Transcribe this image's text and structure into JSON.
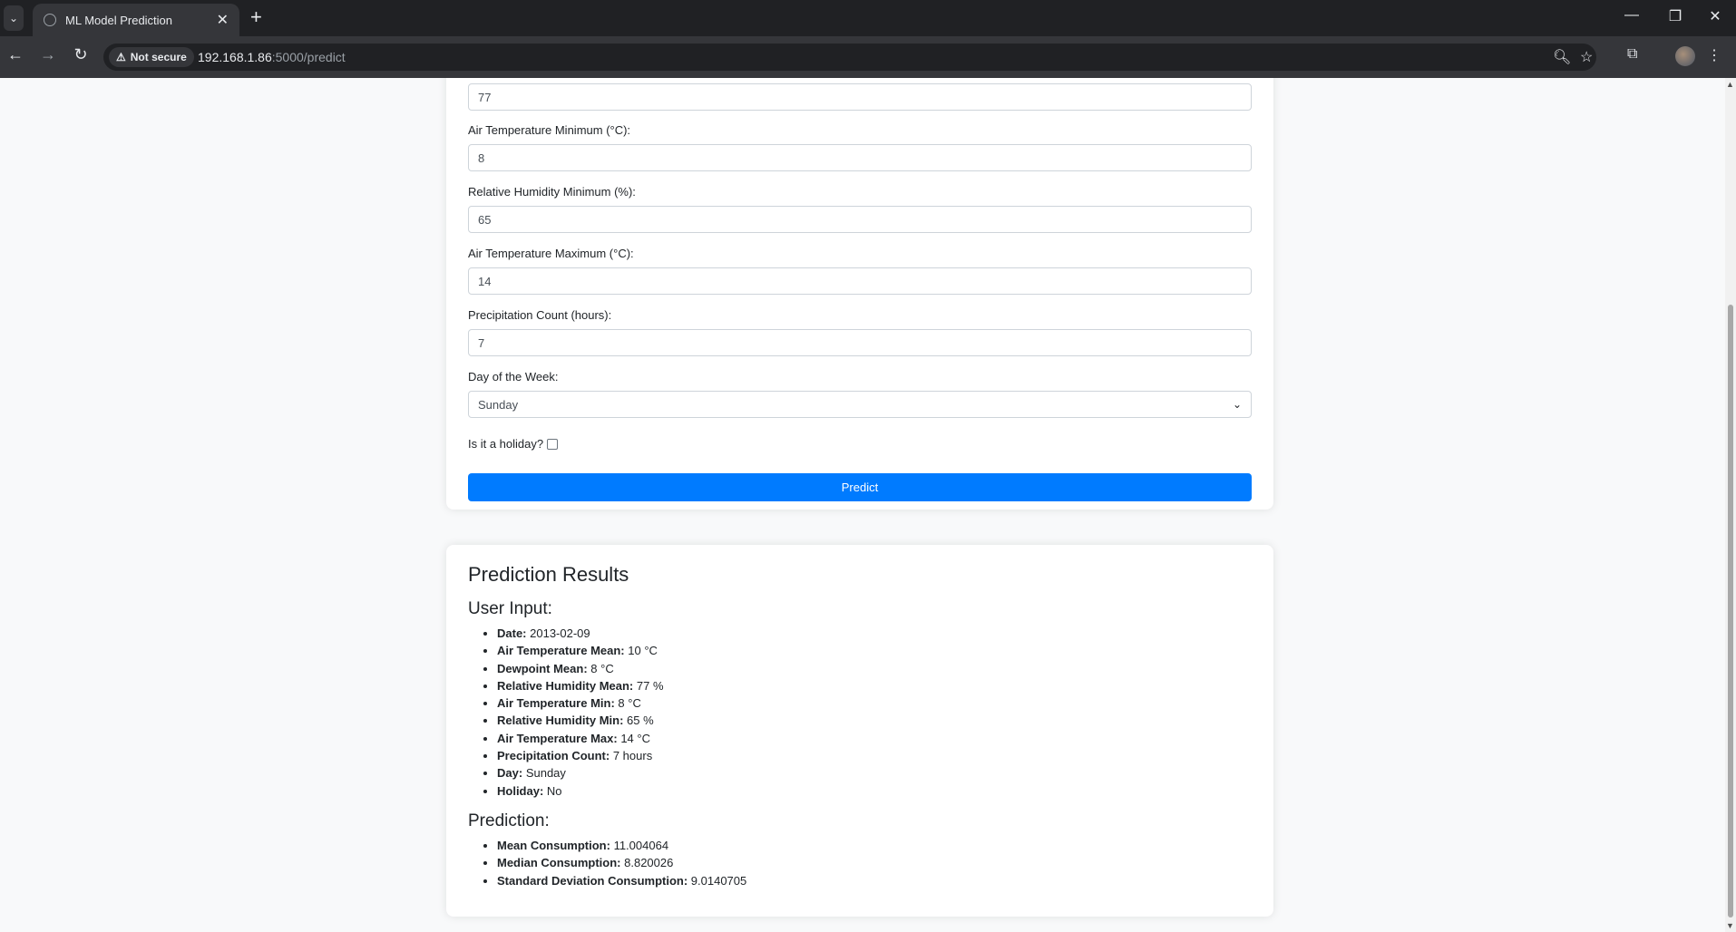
{
  "browser": {
    "tab_title": "ML Model Prediction",
    "security_label": "Not secure",
    "url_host": "192.168.1.86",
    "url_path": ":5000/predict"
  },
  "form": {
    "top_value": "77",
    "fields": [
      {
        "label": "Air Temperature Minimum (°C):",
        "value": "8"
      },
      {
        "label": "Relative Humidity Minimum (%):",
        "value": "65"
      },
      {
        "label": "Air Temperature Maximum (°C):",
        "value": "14"
      },
      {
        "label": "Precipitation Count (hours):",
        "value": "7"
      }
    ],
    "day_label": "Day of the Week:",
    "day_value": "Sunday",
    "holiday_label": "Is it a holiday?",
    "holiday_checked": false,
    "predict_label": "Predict"
  },
  "results": {
    "title": "Prediction Results",
    "user_input_heading": "User Input:",
    "user_input": [
      {
        "key": "Date:",
        "value": "2013-02-09"
      },
      {
        "key": "Air Temperature Mean:",
        "value": "10 °C"
      },
      {
        "key": "Dewpoint Mean:",
        "value": "8 °C"
      },
      {
        "key": "Relative Humidity Mean:",
        "value": "77 %"
      },
      {
        "key": "Air Temperature Min:",
        "value": "8 °C"
      },
      {
        "key": "Relative Humidity Min:",
        "value": "65 %"
      },
      {
        "key": "Air Temperature Max:",
        "value": "14 °C"
      },
      {
        "key": "Precipitation Count:",
        "value": "7 hours"
      },
      {
        "key": "Day:",
        "value": "Sunday"
      },
      {
        "key": "Holiday:",
        "value": "No"
      }
    ],
    "prediction_heading": "Prediction:",
    "prediction": [
      {
        "key": "Mean Consumption:",
        "value": "11.004064"
      },
      {
        "key": "Median Consumption:",
        "value": "8.820026"
      },
      {
        "key": "Standard Deviation Consumption:",
        "value": "9.0140705"
      }
    ]
  },
  "colors": {
    "primary_button": "#007bff",
    "page_bg": "#f8f9fa",
    "chrome_dark": "#202124"
  }
}
